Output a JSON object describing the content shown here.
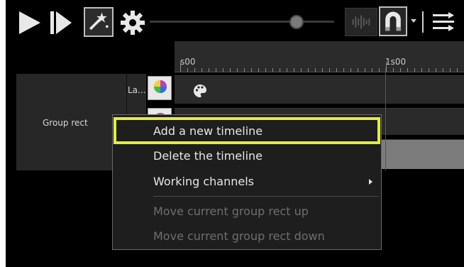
{
  "toolbar": {
    "icons": [
      "play-icon",
      "step-forward-icon",
      "magic-wand-icon",
      "gear-icon",
      "waveform-icon",
      "magnet-icon",
      "dropdown-arrow-icon",
      "sort-list-icon"
    ],
    "slider_value": 0.77
  },
  "ruler": {
    "labels": [
      "s00",
      "1s00"
    ]
  },
  "group": {
    "label": "Group rect"
  },
  "layer": {
    "label": "La..."
  },
  "context_menu": {
    "items": [
      {
        "label": "Add a new timeline",
        "enabled": true,
        "highlighted": true
      },
      {
        "label": "Delete the timeline",
        "enabled": true
      },
      {
        "label": "Working channels",
        "enabled": true,
        "has_submenu": true
      },
      {
        "label": "Move current group rect up",
        "enabled": false
      },
      {
        "label": "Move current group rect down",
        "enabled": false
      }
    ]
  },
  "colors": {
    "highlight": "#e2ee3a",
    "playhead": "#c62828",
    "background": "#000000"
  }
}
